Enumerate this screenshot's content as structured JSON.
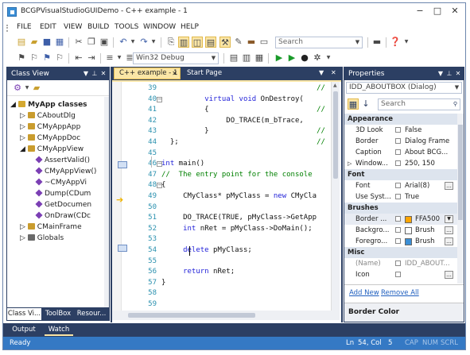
{
  "window": {
    "title": "BCGPVisualStudioGUIDemo - C++ example - 1",
    "minimize": "−",
    "maximize": "□",
    "close": "✕"
  },
  "menu": [
    "FILE",
    "EDIT",
    "VIEW",
    "BUILD",
    "TOOLS",
    "WINDOW",
    "HELP"
  ],
  "toolbar": {
    "search_placeholder": "Search",
    "config_combo": "Win32 Debug"
  },
  "class_view": {
    "title": "Class View",
    "tree": [
      {
        "label": "MyApp classes",
        "level": 0,
        "kind": "root",
        "bold": true
      },
      {
        "label": "CAboutDlg",
        "level": 1,
        "kind": "class"
      },
      {
        "label": "CMyAppApp",
        "level": 1,
        "kind": "class"
      },
      {
        "label": "CMyAppDoc",
        "level": 1,
        "kind": "class"
      },
      {
        "label": "CMyAppView",
        "level": 1,
        "kind": "class"
      },
      {
        "label": "AssertValid()",
        "level": 2,
        "kind": "method"
      },
      {
        "label": "CMyAppView()",
        "level": 2,
        "kind": "method"
      },
      {
        "label": "~CMyAppVi",
        "level": 2,
        "kind": "method"
      },
      {
        "label": "Dump(CDum",
        "level": 2,
        "kind": "method"
      },
      {
        "label": "GetDocumen",
        "level": 2,
        "kind": "method"
      },
      {
        "label": "OnDraw(CDc",
        "level": 2,
        "kind": "method"
      },
      {
        "label": "CMainFrame",
        "level": 1,
        "kind": "class"
      },
      {
        "label": "Globals",
        "level": 1,
        "kind": "folder"
      }
    ],
    "tabs": [
      "Class Vi...",
      "ToolBox",
      "Resour..."
    ]
  },
  "editor": {
    "tabs": [
      "C++ example - 1",
      "Start Page"
    ],
    "lines": [
      {
        "n": "39",
        "segs": [
          [
            "tx",
            "                                    "
          ],
          [
            "cm",
            "//  de"
          ]
        ]
      },
      {
        "n": "40",
        "segs": [
          [
            "tx",
            "          "
          ],
          [
            "kw",
            "virtual"
          ],
          [
            "tx",
            " "
          ],
          [
            "kw",
            "void"
          ],
          [
            "tx",
            " OnDestroy("
          ]
        ]
      },
      {
        "n": "41",
        "segs": [
          [
            "tx",
            "          {                         "
          ],
          [
            "cm",
            "//  To"
          ]
        ]
      },
      {
        "n": "42",
        "segs": [
          [
            "tx",
            "               DO_TRACE(m_bTrace,"
          ]
        ]
      },
      {
        "n": "43",
        "segs": [
          [
            "tx",
            "          }                         "
          ],
          [
            "cm",
            "//  To"
          ]
        ]
      },
      {
        "n": "44",
        "segs": [
          [
            "tx",
            "  };                                "
          ],
          [
            "cm",
            "//  \"th"
          ]
        ]
      },
      {
        "n": "45",
        "segs": [
          [
            "tx",
            ""
          ]
        ]
      },
      {
        "n": "46",
        "segs": [
          [
            "kw",
            "int"
          ],
          [
            "tx",
            " main()"
          ]
        ]
      },
      {
        "n": "47",
        "segs": [
          [
            "cm",
            "//  The entry point for the console"
          ]
        ]
      },
      {
        "n": "48",
        "segs": [
          [
            "tx",
            "{"
          ]
        ]
      },
      {
        "n": "49",
        "segs": [
          [
            "tx",
            "     CMyClass* pMyClass = "
          ],
          [
            "kw",
            "new"
          ],
          [
            "tx",
            " CMyCla"
          ]
        ]
      },
      {
        "n": "50",
        "segs": [
          [
            "tx",
            ""
          ]
        ]
      },
      {
        "n": "51",
        "segs": [
          [
            "tx",
            "     DO_TRACE(TRUE, pMyClass->GetApp"
          ]
        ]
      },
      {
        "n": "52",
        "segs": [
          [
            "tx",
            "     "
          ],
          [
            "kw",
            "int"
          ],
          [
            "tx",
            " nRet = pMyClass->DoMain();"
          ]
        ]
      },
      {
        "n": "53",
        "segs": [
          [
            "tx",
            ""
          ]
        ]
      },
      {
        "n": "54",
        "segs": [
          [
            "tx",
            "     "
          ],
          [
            "kw",
            "delete"
          ],
          [
            "tx",
            " pMyClass;"
          ]
        ]
      },
      {
        "n": "55",
        "segs": [
          [
            "tx",
            ""
          ]
        ]
      },
      {
        "n": "56",
        "segs": [
          [
            "tx",
            "     "
          ],
          [
            "kw",
            "return"
          ],
          [
            "tx",
            " nRet;"
          ]
        ]
      },
      {
        "n": "57",
        "segs": [
          [
            "tx",
            "}"
          ]
        ]
      },
      {
        "n": "58",
        "segs": [
          [
            "tx",
            ""
          ]
        ]
      },
      {
        "n": "59",
        "segs": [
          [
            "tx",
            ""
          ]
        ]
      }
    ]
  },
  "properties": {
    "title": "Properties",
    "object_combo": "IDD_ABOUTBOX (Dialog)",
    "search_placeholder": "Search",
    "categories": {
      "appearance": "Appearance",
      "font": "Font",
      "brushes": "Brushes",
      "misc": "Misc"
    },
    "rows": {
      "look": [
        "3D Look",
        "False"
      ],
      "border": [
        "Border",
        "Dialog Frame"
      ],
      "caption": [
        "Caption",
        "About BCG..."
      ],
      "window": [
        "Window...",
        "250, 150"
      ],
      "font": [
        "Font",
        "Arial(8)"
      ],
      "usesys": [
        "Use Syst...",
        "True"
      ],
      "bordercol": [
        "Border ...",
        "FFA500"
      ],
      "bkgnd": [
        "Backgro...",
        "Brush"
      ],
      "foregr": [
        "Foregro...",
        "Brush"
      ],
      "name": [
        "(Name)",
        "IDD_ABOUT..."
      ],
      "icon": [
        "Icon",
        ""
      ]
    },
    "links": [
      "Add New",
      "Remove All"
    ],
    "description": "Border Color",
    "accent": "#ffa500"
  },
  "bottom_tabs": [
    "Output",
    "Watch"
  ],
  "status": {
    "ready": "Ready",
    "ln": "Ln",
    "ln_val": "54, Col",
    "col_val": "5",
    "cap": "CAP",
    "num": "NUM",
    "scrl": "SCRL"
  }
}
